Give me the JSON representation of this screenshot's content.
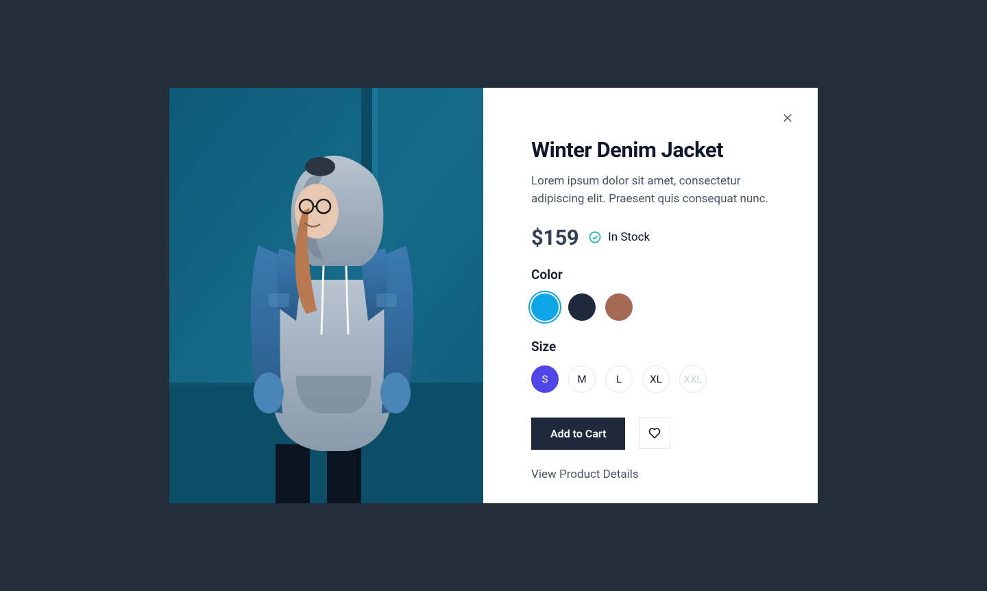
{
  "product": {
    "title": "Winter Denim Jacket",
    "description": "Lorem ipsum dolor sit amet, consectetur adipiscing elit. Praesent quis consequat nunc.",
    "price": "$159",
    "stock_status": "In Stock"
  },
  "options": {
    "color_label": "Color",
    "colors": [
      {
        "name": "blue",
        "hex": "#0ea5e9",
        "selected": true
      },
      {
        "name": "navy",
        "hex": "#1e293b",
        "selected": false
      },
      {
        "name": "brown",
        "hex": "#a56a54",
        "selected": false
      }
    ],
    "size_label": "Size",
    "sizes": [
      {
        "label": "S",
        "selected": true,
        "available": true
      },
      {
        "label": "M",
        "selected": false,
        "available": true
      },
      {
        "label": "L",
        "selected": false,
        "available": true
      },
      {
        "label": "XL",
        "selected": false,
        "available": true
      },
      {
        "label": "XXL",
        "selected": false,
        "available": false
      }
    ]
  },
  "actions": {
    "add_to_cart_label": "Add to Cart",
    "details_link_label": "View Product Details"
  },
  "icons": {
    "close": "close-icon",
    "check_circle": "check-circle-icon",
    "heart": "heart-icon"
  }
}
